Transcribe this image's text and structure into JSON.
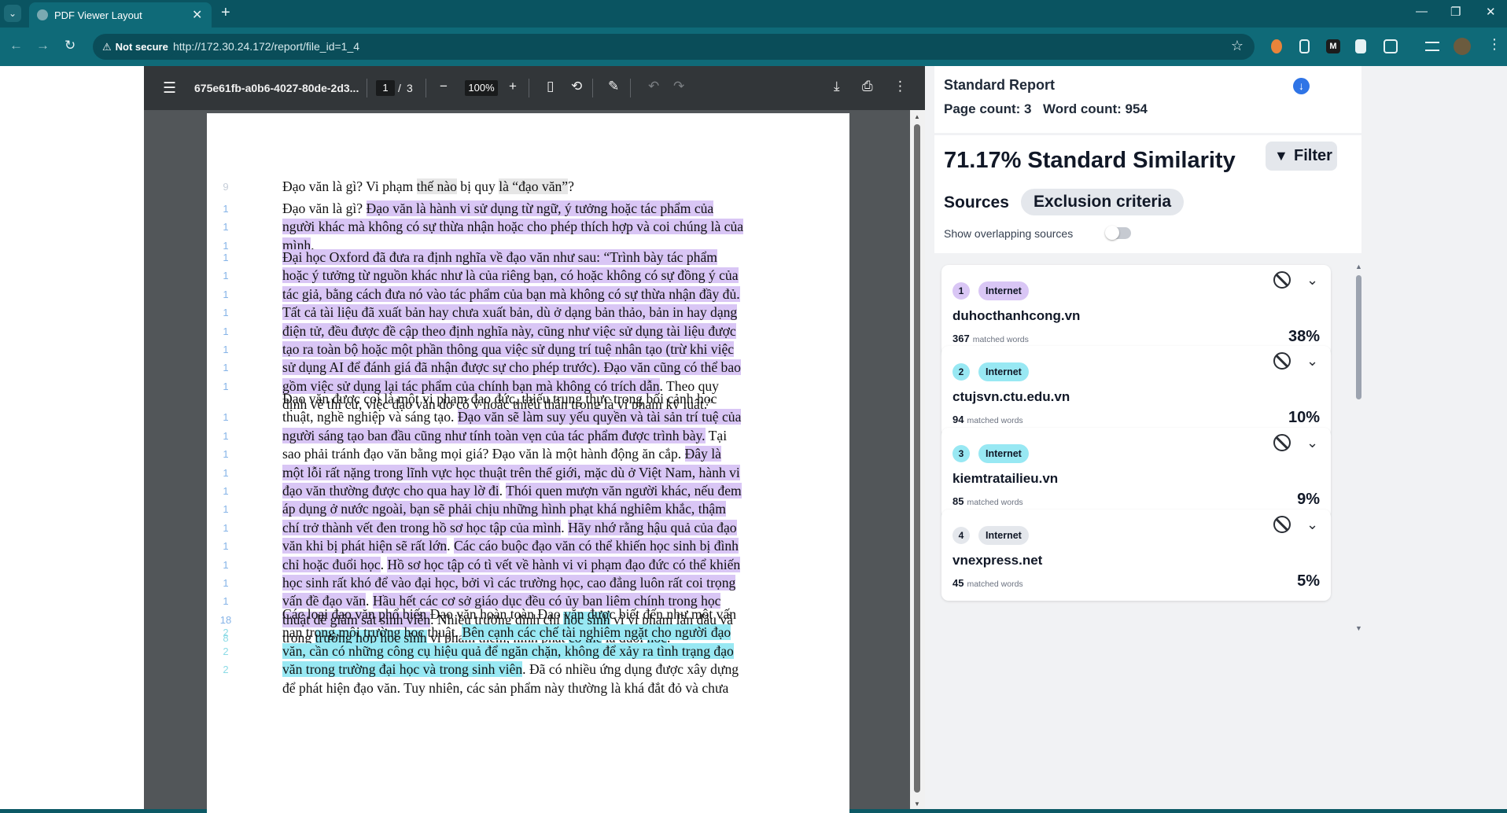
{
  "browser": {
    "tab_title": "PDF Viewer Layout",
    "security_label": "Not secure",
    "url": "http://172.30.24.172/report/file_id=1_4",
    "accent": "#0f6a78"
  },
  "pdf": {
    "filename": "675e61fb-a0b6-4027-80de-2d3...",
    "current_page": "1",
    "page_separator": "/",
    "total_pages": "3",
    "zoom": "100%",
    "paragraphs": [
      {
        "margin": [
          {
            "n": "9",
            "line": 0,
            "color": "blue"
          }
        ],
        "lines": [
          [
            {
              "t": "Đạo văn là gì? Vi phạm "
            },
            {
              "t": "thế nào",
              "h": "g"
            },
            {
              "t": " bị quy "
            },
            {
              "t": "là “đạo văn”",
              "h": "g"
            },
            {
              "t": "?"
            }
          ]
        ]
      },
      {
        "margin": [
          {
            "n": "1",
            "line": 0
          },
          {
            "n": "1",
            "line": 1
          },
          {
            "n": "1",
            "line": 2
          }
        ],
        "lines": [
          [
            {
              "t": "Đạo văn là gì? "
            },
            {
              "t": " Đạo văn là hành vi sử dụng từ ngữ, ý tưởng hoặc tác phẩm của",
              "h": "p"
            }
          ],
          [
            {
              "t": "người khác mà không có sự thừa nhận hoặc cho phép thích hợp và coi chúng là của",
              "h": "p"
            }
          ],
          [
            {
              "t": "mình",
              "h": "p"
            },
            {
              "t": "."
            }
          ]
        ]
      },
      {
        "margin": [
          {
            "n": "1",
            "line": 0
          },
          {
            "n": "1",
            "line": 1
          },
          {
            "n": "1",
            "line": 2
          },
          {
            "n": "1",
            "line": 3
          },
          {
            "n": "1",
            "line": 4
          },
          {
            "n": "1",
            "line": 5
          },
          {
            "n": "1",
            "line": 6
          },
          {
            "n": "1",
            "line": 7
          }
        ],
        "lines": [
          [
            {
              "t": "Đại học Oxford đã đưa ra định nghĩa về đạo văn như sau: “Trình bày tác phẩm",
              "h": "p"
            }
          ],
          [
            {
              "t": "hoặc ý tưởng từ nguồn khác như là của riêng bạn, có hoặc không có sự đồng ý của",
              "h": "p"
            }
          ],
          [
            {
              "t": "tác giả, bằng cách đưa nó vào tác phẩm của bạn mà không có sự thừa nhận đầy đủ.",
              "h": "p"
            }
          ],
          [
            {
              "t": "Tất cả tài liệu đã xuất bản hay chưa xuất bản, dù ở dạng bản thảo, bản in hay dạng",
              "h": "p"
            }
          ],
          [
            {
              "t": "điện tử, đều được đề cập theo định nghĩa này, cũng như việc sử dụng tài liệu được",
              "h": "p"
            }
          ],
          [
            {
              "t": "tạo ra toàn bộ hoặc một phần thông qua việc sử dụng trí tuệ nhân tạo (trừ khi việc",
              "h": "p"
            }
          ],
          [
            {
              "t": "sử dụng AI để đánh giá đã nhận được sự cho phép trước). Đạo văn cũng có thể bao",
              "h": "p"
            }
          ],
          [
            {
              "t": "gồm việc sử dụng lại tác phẩm của chính bạn mà không có trích dẫn",
              "h": "p"
            },
            {
              "t": ". Theo quy"
            }
          ],
          [
            {
              "t": "định về thi cử, việc đạo văn do cố ý hoặc thiếu thận trọng là vi phạm kỷ luật.”"
            }
          ]
        ]
      },
      {
        "margin": [
          {
            "n": "1",
            "line": 1
          },
          {
            "n": "1",
            "line": 2
          },
          {
            "n": "1",
            "line": 3
          },
          {
            "n": "1",
            "line": 4
          },
          {
            "n": "1",
            "line": 5
          },
          {
            "n": "1",
            "line": 6
          },
          {
            "n": "1",
            "line": 7
          },
          {
            "n": "1",
            "line": 8
          },
          {
            "n": "1",
            "line": 9
          },
          {
            "n": "1",
            "line": 10
          },
          {
            "n": "1",
            "line": 11
          },
          {
            "n": "18",
            "line": 12
          },
          {
            "n": "8",
            "line": 13,
            "color": "cyan"
          }
        ],
        "lines": [
          [
            {
              "t": " Đạo văn được coi là một vi phạm đạo đức, thiếu trung thực trong bối cảnh học"
            }
          ],
          [
            {
              "t": "thuật, nghề nghiệp và sáng tạo. "
            },
            {
              "t": "Đạo văn sẽ làm suy yếu quyền và tài sản trí tuệ của",
              "h": "p"
            }
          ],
          [
            {
              "t": "người sáng tạo ban đầu cũng như tính toàn vẹn của tác phẩm được trình bày.",
              "h": "p"
            },
            {
              "t": "  Tại"
            }
          ],
          [
            {
              "t": "sao phải tránh đạo văn bằng mọi giá? Đạo văn là một hành động ăn cắp. "
            },
            {
              "t": "Đây là",
              "h": "p"
            }
          ],
          [
            {
              "t": "một lỗi rất nặng trong lĩnh vực học thuật trên thế giới, mặc dù ở Việt Nam, hành vi",
              "h": "p"
            }
          ],
          [
            {
              "t": "đạo văn thường được cho qua hay lờ đi",
              "h": "p"
            },
            {
              "t": ". "
            },
            {
              "t": "Thói quen mượn văn người khác, nếu đem",
              "h": "p"
            }
          ],
          [
            {
              "t": "áp dụng ở nước ngoài, bạn sẽ phải chịu những hình phạt khá nghiêm khắc, thậm",
              "h": "p"
            }
          ],
          [
            {
              "t": "chí trở thành vết đen trong hồ sơ học tập của mình",
              "h": "p"
            },
            {
              "t": ". "
            },
            {
              "t": "Hãy nhớ rằng hậu quả của đạo",
              "h": "p"
            }
          ],
          [
            {
              "t": "văn khi bị phát hiện sẽ rất lớn",
              "h": "p"
            },
            {
              "t": ". "
            },
            {
              "t": "Các cáo buộc đạo văn có thể khiến học sinh bị đình",
              "h": "p"
            }
          ],
          [
            {
              "t": "chỉ hoặc đuổi học",
              "h": "p"
            },
            {
              "t": ". "
            },
            {
              "t": "Hồ sơ học tập có tì vết về hành vi vi phạm đạo đức có thể khiến",
              "h": "p"
            }
          ],
          [
            {
              "t": "học sinh rất khó để vào đại học, bởi vì các trường học, cao đẳng luôn rất coi trọng",
              "h": "p"
            }
          ],
          [
            {
              "t": "vấn đề đạo văn",
              "h": "p"
            },
            {
              "t": ". "
            },
            {
              "t": "Hầu hết các cơ sở giáo dục đều có ủy ban liêm chính trong học",
              "h": "p"
            }
          ],
          [
            {
              "t": "thuật để giám sát sinh viên",
              "h": "p"
            },
            {
              "t": ". Nhiều trường đình chỉ "
            },
            {
              "t": "học sinh",
              "h": "c"
            },
            {
              "t": " vì vi phạm lần đầu và"
            }
          ],
          [
            {
              "t": "trong "
            },
            {
              "t": "trường hợp học sinh",
              "h": "c"
            },
            {
              "t": " vi phạm thêm, hình phạt "
            },
            {
              "t": "có thể",
              "h": "c"
            },
            {
              "t": " là đuổi "
            },
            {
              "t": "học",
              "h": "c"
            },
            {
              "t": "."
            }
          ]
        ]
      },
      {
        "margin": [
          {
            "n": "2",
            "line": 1,
            "color": "cyan"
          },
          {
            "n": "2",
            "line": 2,
            "color": "cyan"
          },
          {
            "n": "2",
            "line": 3,
            "color": "cyan"
          }
        ],
        "lines": [
          [
            {
              "t": "Các loại đạo văn phổ biến Đạo văn hoàn toàn Đạo văn được biết đến như một vấn"
            }
          ],
          [
            {
              "t": "nạn trong môi trường học thuật. "
            },
            {
              "t": "Bên cạnh các chế tài nghiêm ngặt cho người đạo",
              "h": "c"
            }
          ],
          [
            {
              "t": "văn, cần có những công cụ hiệu quả để ngăn chặn, không để xảy ra tình trạng đạo",
              "h": "c"
            }
          ],
          [
            {
              "t": "văn trong trường đại học và trong sinh viên",
              "h": "c"
            },
            {
              "t": ". Đã có nhiều ứng dụng được xây dựng"
            }
          ],
          [
            {
              "t": "để phát hiện đạo văn. Tuy nhiên, các sản phẩm này thường là khá đắt đỏ và chưa"
            }
          ]
        ]
      }
    ]
  },
  "report": {
    "title": "Standard Report",
    "page_count": "Page count: 3",
    "word_count": "Word count: 954",
    "similarity_title": "71.17% Standard Similarity",
    "filter_label": "Filter",
    "sources_tab": "Sources",
    "exclusion_tab": "Exclusion criteria",
    "overlap_label": "Show overlapping sources",
    "overlap_enabled": false,
    "matched_words_label": "matched words",
    "sources": [
      {
        "num": "1",
        "type": "Internet",
        "domain": "duhocthanhcong.vn",
        "matched": "367",
        "percent": "38%",
        "color": "#d9c6f5"
      },
      {
        "num": "2",
        "type": "Internet",
        "domain": "ctujsvn.ctu.edu.vn",
        "matched": "94",
        "percent": "10%",
        "color": "#98e8f3"
      },
      {
        "num": "3",
        "type": "Internet",
        "domain": "kiemtratailieu.vn",
        "matched": "85",
        "percent": "9%",
        "color": "#98e8f3"
      },
      {
        "num": "4",
        "type": "Internet",
        "domain": "vnexpress.net",
        "matched": "45",
        "percent": "5%",
        "color": "#e4e7ec"
      }
    ]
  }
}
